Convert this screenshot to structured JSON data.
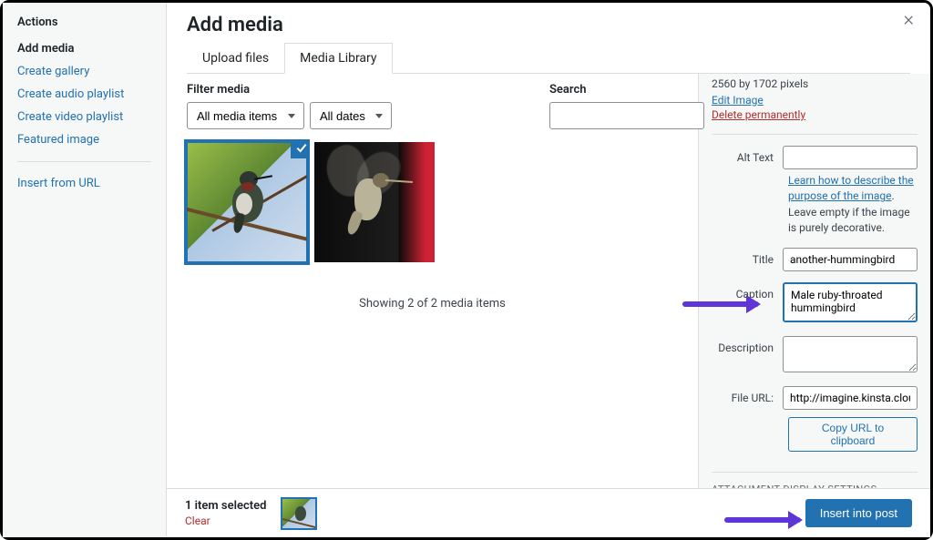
{
  "sidebar": {
    "heading": "Actions",
    "items": [
      {
        "label": "Add media",
        "active": true
      },
      {
        "label": "Create gallery"
      },
      {
        "label": "Create audio playlist"
      },
      {
        "label": "Create video playlist"
      },
      {
        "label": "Featured image"
      }
    ],
    "insertFromUrl": "Insert from URL"
  },
  "header": {
    "title": "Add media"
  },
  "tabs": {
    "upload": "Upload files",
    "library": "Media Library"
  },
  "filter": {
    "label": "Filter media",
    "allItems": "All media items",
    "allDates": "All dates"
  },
  "search": {
    "label": "Search",
    "value": ""
  },
  "resultsCount": "Showing 2 of 2 media items",
  "details": {
    "dimensions": "2560 by 1702 pixels",
    "editImage": "Edit Image",
    "deletePermanently": "Delete permanently",
    "altLabel": "Alt Text",
    "altValue": "",
    "altHintLinkText": "Learn how to describe the purpose of the image",
    "altHintTail": ". Leave empty if the image is purely decorative.",
    "titleLabel": "Title",
    "titleValue": "another-hummingbird",
    "captionLabel": "Caption",
    "captionValue": "Male ruby-throated hummingbird",
    "descLabel": "Description",
    "descValue": "",
    "fileUrlLabel": "File URL:",
    "fileUrlValue": "http://imagine.kinsta.cloud",
    "copyBtn": "Copy URL to clipboard",
    "attachmentDisplayHeading": "ATTACHMENT DISPLAY SETTINGS"
  },
  "footer": {
    "selectedText": "1 item selected",
    "clear": "Clear",
    "insert": "Insert into post"
  }
}
